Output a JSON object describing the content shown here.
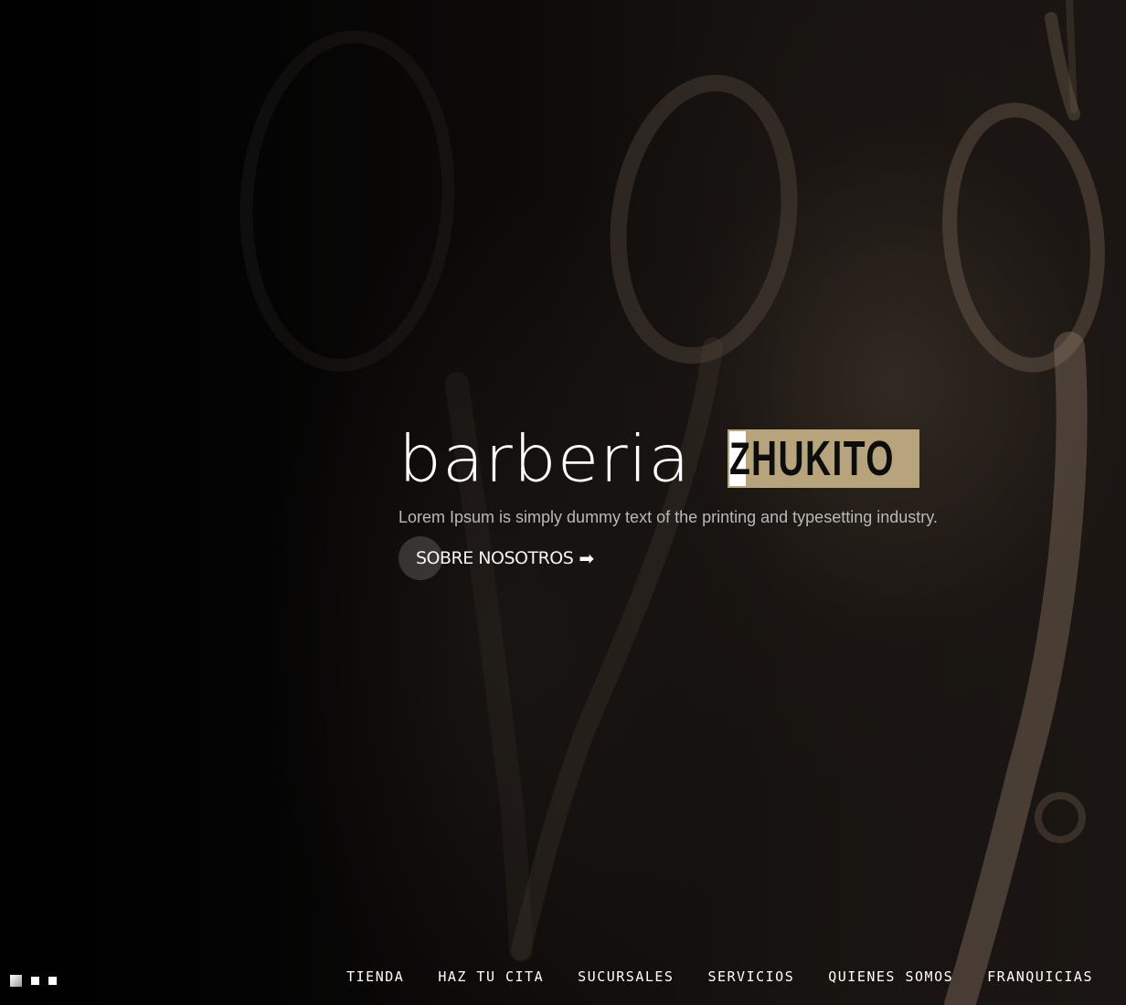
{
  "hero": {
    "title_word": "barberia",
    "logo_first_letter": "Z",
    "logo_rest": "HUKITO",
    "subtitle": "Lorem Ipsum is simply dummy text of the printing and typesetting industry.",
    "cta_label": "SOBRE NOSOTROS",
    "cta_icon": "arrow-right-icon",
    "logo_gold": "#b8a47c"
  },
  "slider": {
    "dots": [
      {
        "state": "active"
      },
      {
        "state": "inactive"
      },
      {
        "state": "inactive"
      }
    ]
  },
  "nav": {
    "items": [
      {
        "label": "TIENDA"
      },
      {
        "label": "HAZ TU CITA"
      },
      {
        "label": "SUCURSALES"
      },
      {
        "label": "SERVICIOS"
      },
      {
        "label": "QUIENES SOMOS"
      },
      {
        "label": "FRANQUICIAS"
      }
    ]
  }
}
